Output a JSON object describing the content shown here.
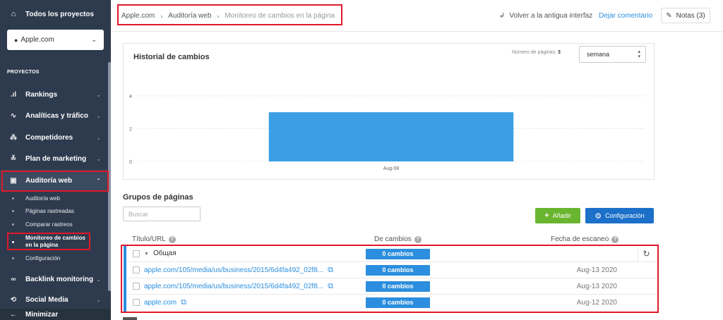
{
  "sidebar": {
    "all_projects": "Todos los proyectos",
    "project": "Apple.com",
    "section_label": "PROYECTOS",
    "items": [
      {
        "label": "Rankings",
        "icon": "bar-chart-icon"
      },
      {
        "label": "Analíticas y tráfico",
        "icon": "pulse-icon"
      },
      {
        "label": "Competidores",
        "icon": "users-icon"
      },
      {
        "label": "Plan de marketing",
        "icon": "checklist-icon"
      },
      {
        "label": "Auditoría web",
        "icon": "audit-icon"
      },
      {
        "label": "Backlink monitoring",
        "icon": "link-icon"
      },
      {
        "label": "Social Media",
        "icon": "share-icon"
      }
    ],
    "sub_items": [
      "Auditoría web",
      "Páginas rastreadas",
      "Comparar rastreos",
      "Monitoreo de cambios en la página",
      "Configuración"
    ],
    "minimize": "Minimizar"
  },
  "header": {
    "breadcrumb": [
      "Apple.com",
      "Auditoría web",
      "Monitoreo de cambios en la página"
    ],
    "back_link": "Volver a la antigua interfaz",
    "comment_link": "Dejar comentario",
    "notes": "Notas (3)"
  },
  "history": {
    "title": "Historial de cambios",
    "pages_label": "Número de páginas:",
    "pages_value": "3",
    "period": "semana"
  },
  "chart_data": {
    "type": "bar",
    "categories": [
      "Aug-08"
    ],
    "values": [
      3
    ],
    "ylim": [
      0,
      4
    ],
    "yticks": [
      0,
      2,
      4
    ],
    "color": "#3a9fe4",
    "grid": true
  },
  "groups": {
    "title": "Grupos de páginas",
    "search_placeholder": "Buscar",
    "add_label": "Añadir",
    "config_label": "Configuración",
    "columns": [
      "Título/URL",
      "De cambios",
      "Fecha de escaneo"
    ],
    "group_row": {
      "name": "Общая",
      "changes": "0 cambios"
    },
    "rows": [
      {
        "url": "apple.com/105/media/us/business/2015/6d4fa492_02f8...",
        "changes": "0 cambios",
        "date": "Aug-13 2020"
      },
      {
        "url": "apple.com/105/media/us/business/2015/6d4fa492_02f8...",
        "changes": "0 cambios",
        "date": "Aug-13 2020"
      },
      {
        "url": "apple.com",
        "changes": "0 cambios",
        "date": "Aug-12 2020"
      }
    ]
  }
}
